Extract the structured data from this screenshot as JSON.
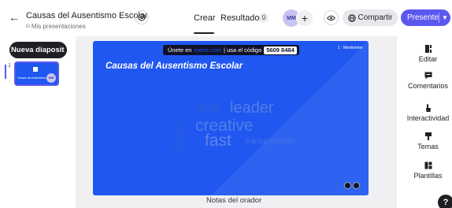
{
  "header": {
    "back_icon": "arrow-left-icon",
    "title": "Causas del Ausentismo Escolar",
    "breadcrumb": "Mis presentaciones",
    "tabs": [
      {
        "label": "Crear",
        "active": true
      },
      {
        "label": "Resultados",
        "count": "0"
      }
    ],
    "collaborator_initials": "MM",
    "add_collaborator_symbol": "+",
    "share_label": "Compartir",
    "present_label": "Presente"
  },
  "sidebar": {
    "new_slide_label": "Nueva diaposit",
    "slides": [
      {
        "number": "1",
        "title": "Causas del Ausentismo",
        "avatar": "MM"
      }
    ]
  },
  "slide": {
    "join_prefix": "Únete en",
    "join_site": "menti.com",
    "join_middle": "| usa el código",
    "join_code": "5609 8484",
    "votes": "1 · Mentimeter",
    "title": "Causas del Ausentismo Escolar",
    "words": [
      "bold",
      "leader",
      "creative",
      "fast",
      "transportation",
      "focus"
    ],
    "background_color": "#1f57f0",
    "accent_color": "#4f7ee6"
  },
  "notes_label": "Notas del orador",
  "right_panel": {
    "items": [
      {
        "label": "Editar",
        "icon": "edit-icon"
      },
      {
        "label": "Comentarios",
        "icon": "comment-icon"
      },
      {
        "label": "Interactividad",
        "icon": "interactivity-icon"
      },
      {
        "label": "Temas",
        "icon": "themes-icon"
      },
      {
        "label": "Plantillas",
        "icon": "templates-icon"
      }
    ]
  },
  "help_label": "?",
  "colors": {
    "primary": "#5b58f0",
    "dark": "#1f1f24"
  }
}
